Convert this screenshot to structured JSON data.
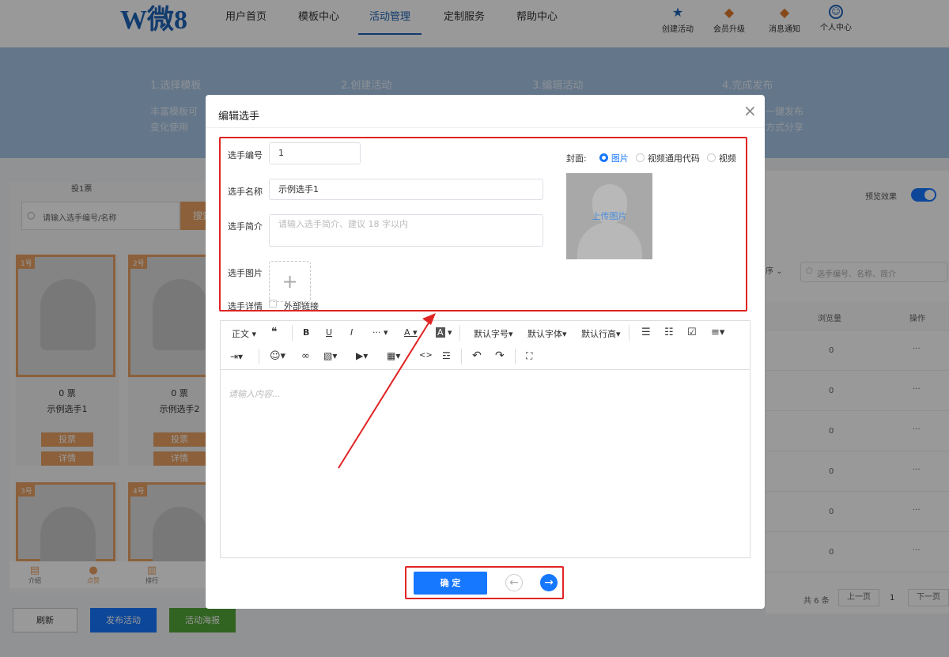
{
  "header": {
    "logo_letter": "W",
    "logo_text": "微8",
    "nav": [
      "用户首页",
      "模板中心",
      "活动管理",
      "定制服务",
      "帮助中心"
    ],
    "icons": [
      {
        "label": "创建活动",
        "icon": "star-icon"
      },
      {
        "label": "会员升级",
        "icon": "diamond-icon"
      },
      {
        "label": "消息通知",
        "icon": "bell-icon"
      },
      {
        "label": "个人中心",
        "icon": "user-icon"
      }
    ]
  },
  "banner": {
    "steps": [
      {
        "title": "1.选择模板",
        "desc1": "丰富模板可",
        "desc2": "变化使用"
      },
      {
        "title": "2.创建活动"
      },
      {
        "title": "3.编辑活动"
      },
      {
        "title": "4.完成发布",
        "desc1": "一键发布",
        "desc2": "方式分享"
      }
    ]
  },
  "phone": {
    "vote_info": "投1票",
    "search_placeholder": "请输入选手编号/名称",
    "search_button": "搜索",
    "cards": [
      {
        "num": "1号",
        "votes": "0 票",
        "name": "示例选手1",
        "vote_btn": "投票",
        "detail_btn": "详情"
      },
      {
        "num": "2号",
        "votes": "0 票",
        "name": "示例选手2",
        "vote_btn": "投票",
        "detail_btn": "详情"
      },
      {
        "num": "3号"
      },
      {
        "num": "4号"
      }
    ],
    "tabbar": [
      "介绍",
      "点赞",
      "排行"
    ]
  },
  "bottom_buttons": {
    "refresh": "刷新",
    "publish": "发布活动",
    "poster": "活动海报"
  },
  "right": {
    "preview_label": "预览效果",
    "sort_fragment": "序",
    "search_placeholder": "选手编号、名称、简介",
    "col_views": "浏览量",
    "col_ops": "操作",
    "rows": [
      {
        "views": "0",
        "ops": "···"
      },
      {
        "views": "0",
        "ops": "···"
      },
      {
        "views": "0",
        "ops": "···"
      },
      {
        "views": "0",
        "ops": "···"
      },
      {
        "views": "0",
        "ops": "···"
      },
      {
        "views": "0",
        "ops": "···"
      }
    ],
    "pager": {
      "total": "共 6 条",
      "prev": "上一页",
      "page": "1",
      "next": "下一页"
    }
  },
  "modal": {
    "title": "编辑选手",
    "close": "×",
    "fields": {
      "number_label": "选手编号",
      "number_value": "1",
      "name_label": "选手名称",
      "name_value": "示例选手1",
      "intro_label": "选手简介",
      "intro_placeholder": "请输入选手简介、建议 18 字以内",
      "image_label": "选手图片",
      "detail_label": "选手详情",
      "external_link": "外部链接"
    },
    "cover": {
      "label": "封面:",
      "options": [
        "图片",
        "视频通用代码",
        "视频"
      ],
      "selected": "图片",
      "upload_text": "上传图片"
    },
    "toolbar": {
      "row1": [
        "正文",
        "❝",
        "B",
        "U",
        "I",
        "···",
        "A",
        "A",
        "默认字号",
        "默认字体",
        "默认行高"
      ],
      "row1_icons": [
        "bullet-list-icon",
        "numbered-list-icon",
        "checkbox-icon",
        "align-icon"
      ],
      "row2": [
        "indent-icon",
        "emoji-icon",
        "link-icon",
        "image-icon",
        "video-icon",
        "table-icon",
        "code-icon",
        "divider-icon",
        "undo-icon",
        "redo-icon",
        "fullscreen-icon"
      ]
    },
    "editor_placeholder": "请输入内容...",
    "confirm": "确 定"
  },
  "colors": {
    "primary": "#1677ff",
    "orange": "#e8a063",
    "green": "#52a537",
    "annotation": "#e02424"
  }
}
